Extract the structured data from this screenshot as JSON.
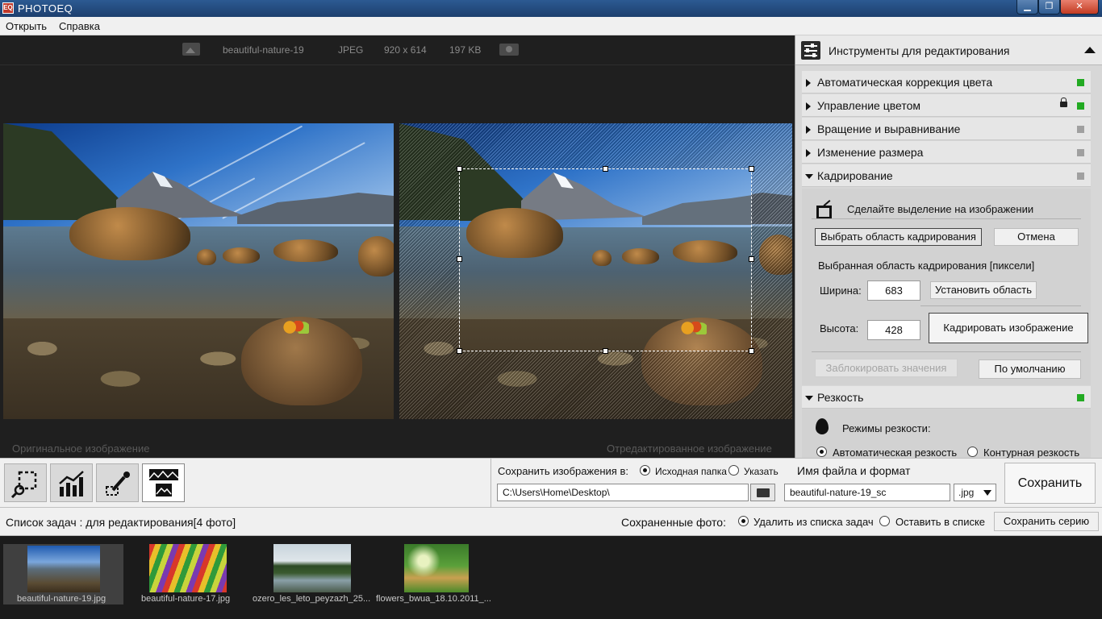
{
  "window": {
    "title": "PHOTOEQ",
    "app_icon": "EQ",
    "minimize": "▁",
    "maximize": "❐",
    "close": "✕"
  },
  "menu": {
    "items": [
      "Открыть",
      "Справка"
    ]
  },
  "image_info": {
    "name": "beautiful-nature-19",
    "format": "JPEG",
    "dimensions": "920 x 614",
    "size": "197 KB"
  },
  "viewer": {
    "original_caption": "Оригинальное изображение",
    "edited_caption": "Отредактированное изображение"
  },
  "panel": {
    "title": "Инструменты для редактирования",
    "sections": [
      {
        "label": "Автоматическая коррекция цвета",
        "status_color": "#22aa22"
      },
      {
        "label": "Управление цветом",
        "status_color": "#22aa22",
        "locked": true
      },
      {
        "label": "Вращение и выравнивание",
        "status_color": "#a0a0a0"
      },
      {
        "label": "Изменение размера",
        "status_color": "#a0a0a0"
      },
      {
        "label": "Кадрирование",
        "status_color": "#a0a0a0",
        "expanded": true
      }
    ],
    "crop": {
      "hint": "Сделайте выделение на изображении",
      "select_area": "Выбрать область кадрирования",
      "cancel": "Отмена",
      "area_label": "Выбранная область кадрирования [пиксели]",
      "width_label": "Ширина:",
      "width_value": "683",
      "set_area": "Установить область",
      "height_label": "Высота:",
      "height_value": "428",
      "crop_image": "Кадрировать изображение",
      "lock_values": "Заблокировать значения",
      "defaults": "По умолчанию"
    },
    "sharpness": {
      "label": "Резкость",
      "status_color": "#22aa22",
      "modes_label": "Режимы резкости:",
      "mode_auto": "Автоматическая резкость",
      "mode_contour": "Контурная резкость"
    }
  },
  "save": {
    "save_to_label": "Сохранить изображения в:",
    "option_source": "Исходная папка",
    "option_specify": "Указать",
    "filename_label": "Имя файла и формат",
    "path": "C:\\Users\\Home\\Desktop\\",
    "filename": "beautiful-nature-19_sc",
    "format": ".jpg",
    "save_button": "Сохранить"
  },
  "tasks": {
    "title": "Список задач : для редактирования[4 фото]",
    "saved_label": "Сохраненные фото:",
    "option_remove": "Удалить из списка задач",
    "option_keep": "Оставить в списке",
    "save_series": "Сохранить серию",
    "thumbnails": [
      {
        "name": "beautiful-nature-19.jpg"
      },
      {
        "name": "beautiful-nature-17.jpg"
      },
      {
        "name": "ozero_les_leto_peyzazh_25..."
      },
      {
        "name": "flowers_bwua_18.10.2011_..."
      }
    ]
  },
  "colors": {
    "accent_green": "#22aa22",
    "panel_bg": "#d7d7d7",
    "viewer_bg": "#1f1f1f"
  }
}
